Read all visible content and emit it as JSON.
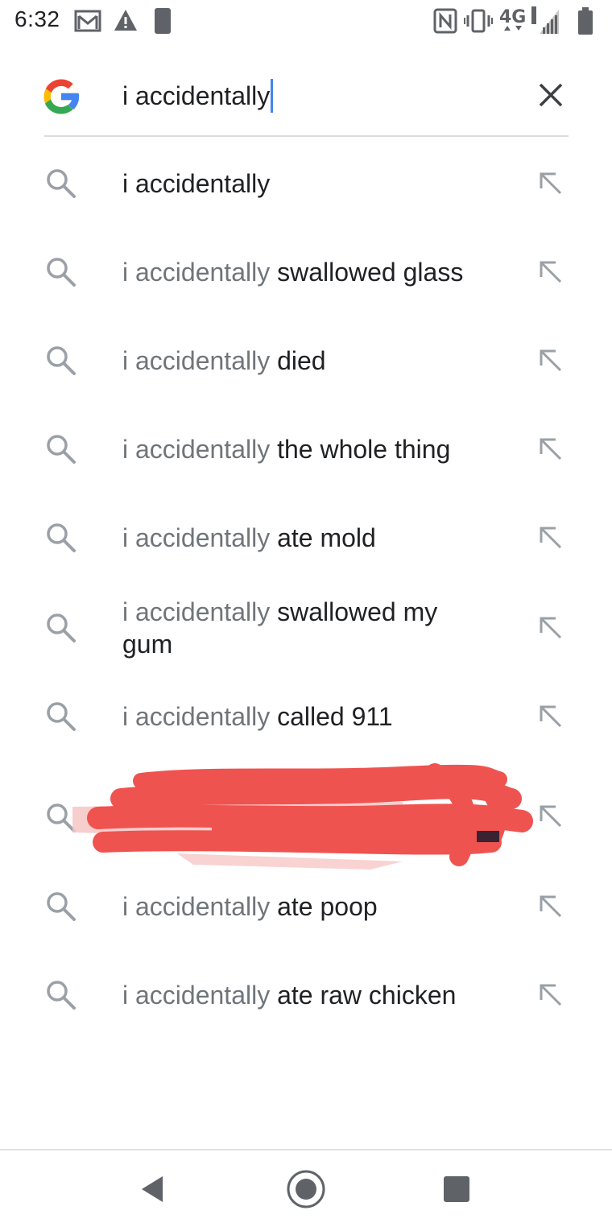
{
  "status_bar": {
    "time": "6:32",
    "icons": [
      "gmail-icon",
      "warning-icon",
      "do-not-disturb-icon",
      "nfc-icon",
      "vibrate-icon",
      "lte-icon",
      "signal-icon",
      "battery-icon"
    ],
    "network_label": "4G"
  },
  "search": {
    "logo": "google-logo",
    "query": "i accidentally",
    "clear_icon": "close-icon"
  },
  "suggestions": [
    {
      "prefix": "i accidentally",
      "completion": ""
    },
    {
      "prefix": "i accidentally",
      "completion": " swallowed glass"
    },
    {
      "prefix": "i accidentally",
      "completion": " died"
    },
    {
      "prefix": "i accidentally",
      "completion": " the whole thing"
    },
    {
      "prefix": "i accidentally",
      "completion": " ate mold"
    },
    {
      "prefix": "i accidentally",
      "completion": " swallowed my gum"
    },
    {
      "prefix": "i accidentally",
      "completion": " called 911"
    },
    {
      "redacted": true
    },
    {
      "prefix": "i accidentally",
      "completion": " ate poop"
    },
    {
      "prefix": "i accidentally",
      "completion": " ate raw chicken"
    }
  ],
  "colors": {
    "google_blue": "#4285f4",
    "google_red": "#ea4335",
    "google_yellow": "#fbbc05",
    "google_green": "#34a853",
    "redaction": "#ef5350",
    "prefix_gray": "#70757a"
  },
  "nav_bar": {
    "buttons": [
      "back-icon",
      "home-icon",
      "recents-icon"
    ]
  }
}
